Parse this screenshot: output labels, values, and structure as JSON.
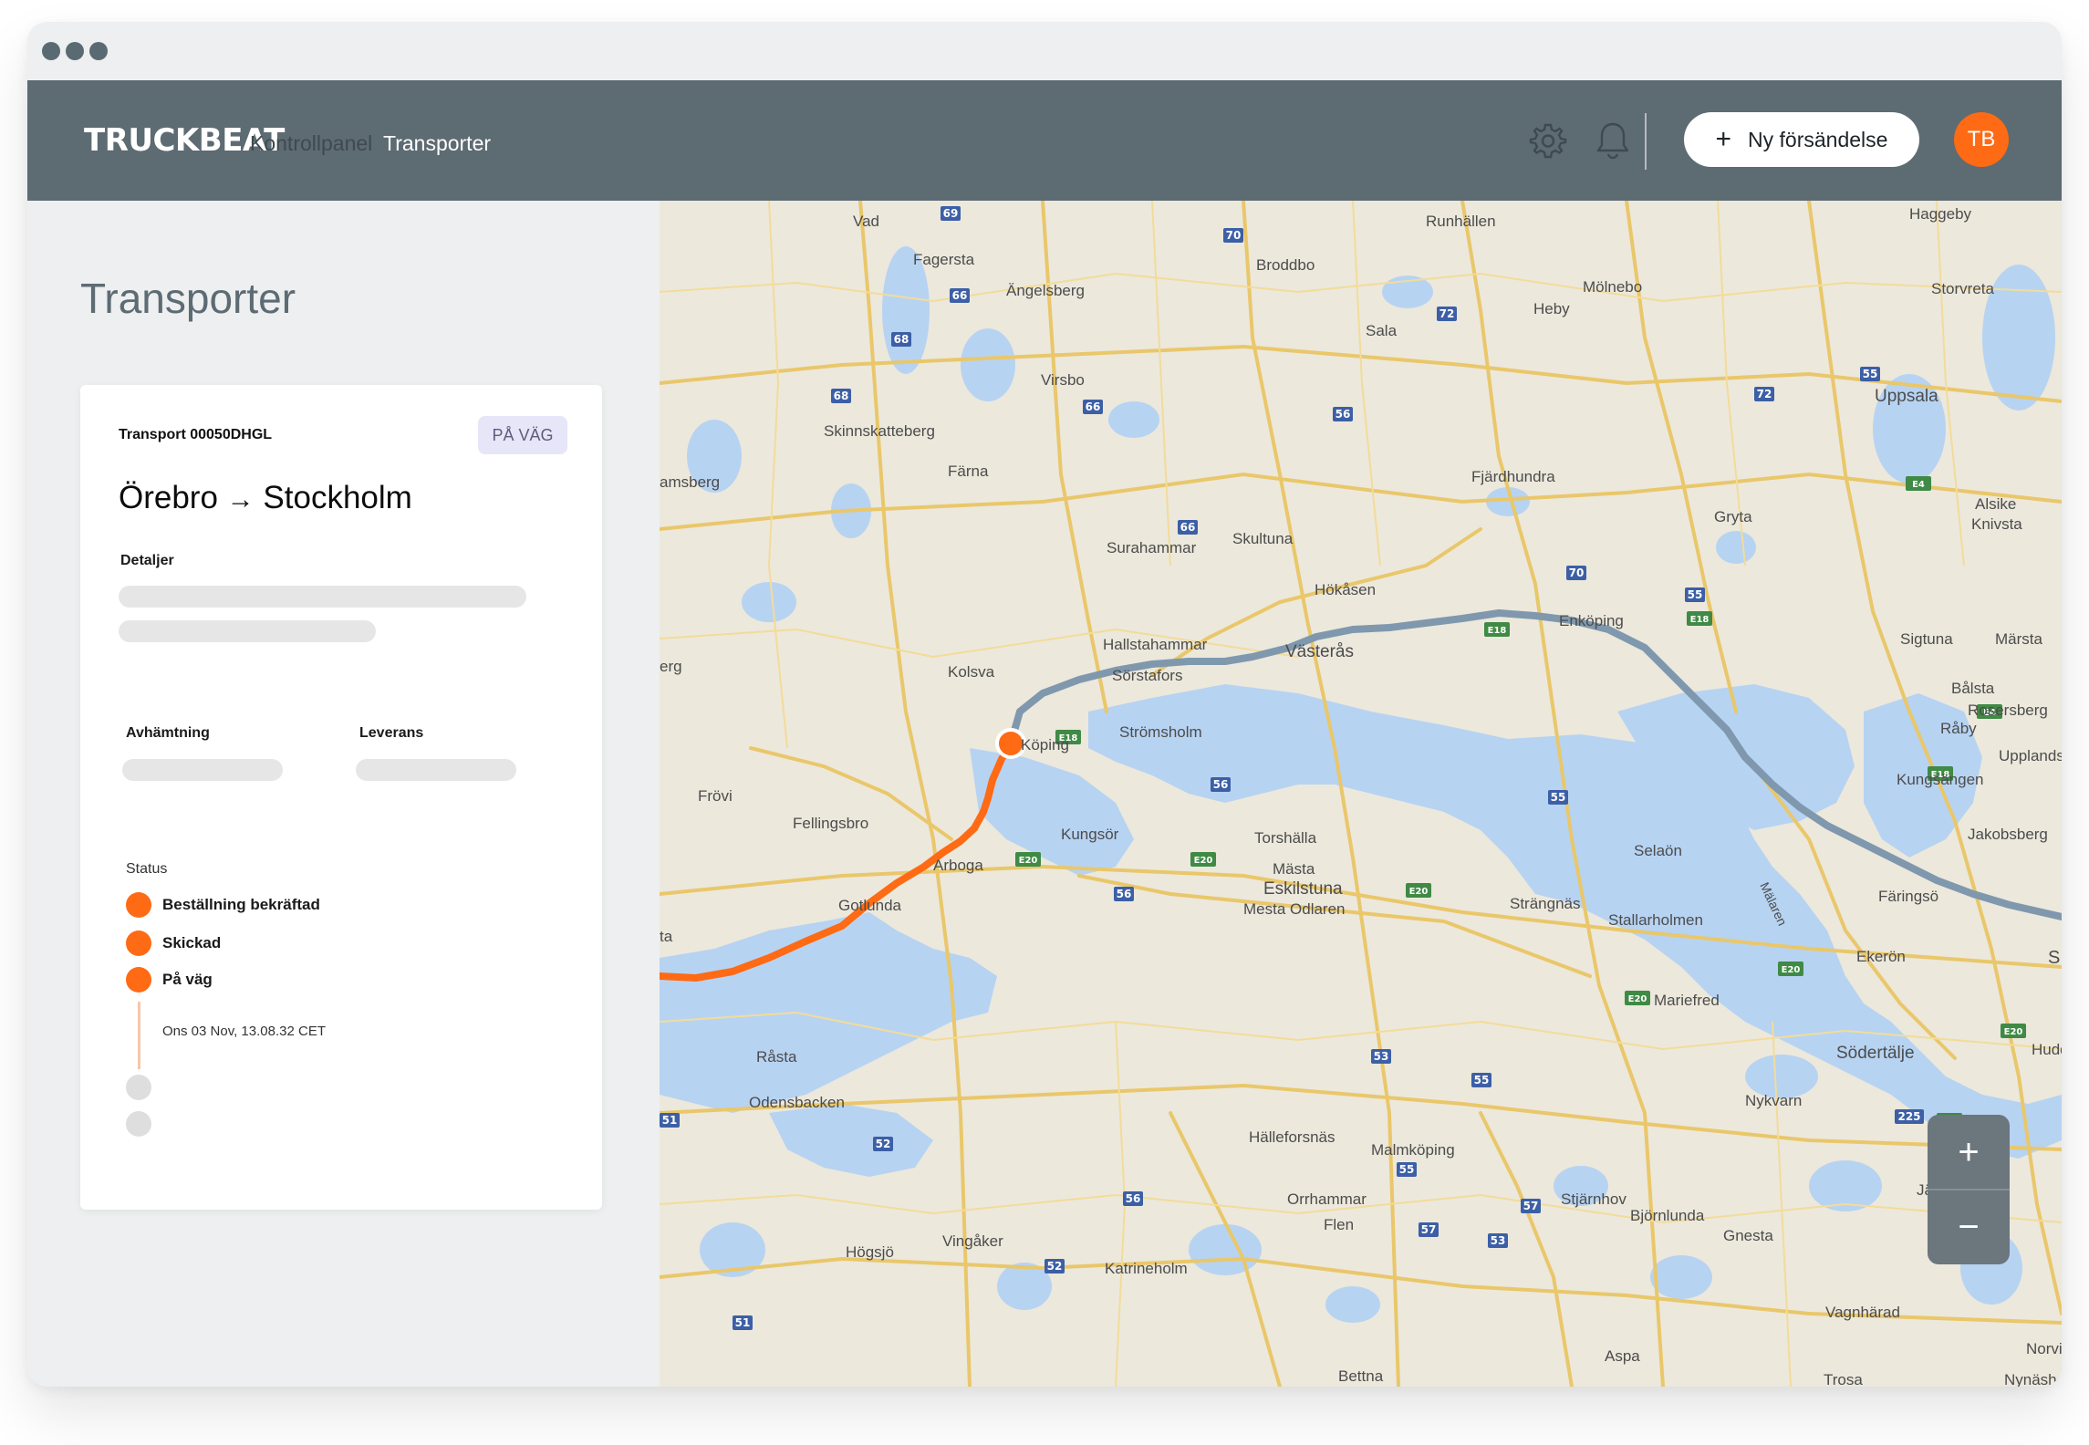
{
  "header": {
    "logo": "TRUCKBEAT",
    "nav": [
      {
        "label": "Kontrollpanel",
        "active": false
      },
      {
        "label": "Transporter",
        "active": true
      }
    ],
    "icons": [
      "gear-icon",
      "bell-icon"
    ],
    "new_shipment_label": "Ny försändelse",
    "avatar_initials": "TB"
  },
  "sidebar": {
    "title": "Transporter",
    "card": {
      "transport_id": "Transport 00050DHGL",
      "badge": "PÅ VÄG",
      "route_from": "Örebro",
      "route_to": "Stockholm",
      "details_label": "Detaljer",
      "pickup_label": "Avhämtning",
      "delivery_label": "Leverans",
      "status_label": "Status",
      "status_steps": [
        {
          "label": "Beställning bekräftad",
          "done": true
        },
        {
          "label": "Skickad",
          "done": true
        },
        {
          "label": "På väg",
          "done": true,
          "timestamp": "Ons 03 Nov, 13.08.32 CET"
        },
        {
          "label": "",
          "done": false
        },
        {
          "label": "",
          "done": false
        }
      ]
    }
  },
  "map": {
    "colors": {
      "traveled": "#ff6a14",
      "remaining": "#7f98ad",
      "water": "#b7d3f2",
      "land": "#ece8dc",
      "road": "#e9c76a",
      "road_shield": "#3c5fa6"
    },
    "places": [
      "Vad",
      "Fagersta",
      "Ängelsberg",
      "Runhällen",
      "Broddbo",
      "Haggeby",
      "Mölnebo",
      "Heby",
      "Sala",
      "Storvreta",
      "Uppsala",
      "Virsbo",
      "Skinnskatteberg",
      "Färna",
      "Fjärdhundra",
      "Gryta",
      "Alsike",
      "Knivsta",
      "Surahammar",
      "Skultuna",
      "Hökåsen",
      "Hallstahammar",
      "Västerås",
      "Enköping",
      "Sigtuna",
      "Märsta",
      "Sörstafors",
      "Kolsva",
      "Köping",
      "Strömsholm",
      "Bålsta",
      "Råby",
      "Rosersberg",
      "Upplands Väsby",
      "Frövi",
      "Fellingsbro",
      "Kungsör",
      "Torshälla",
      "Selaön",
      "Kungsängen",
      "Jakobsberg",
      "Arboga",
      "Mälaren",
      "Gotlunda",
      "Mästa",
      "Eskilstuna",
      "Strängnäs",
      "Färingsö",
      "Mesta Odlaren",
      "Stallarholmen",
      "Ekerön",
      "Mariefred",
      "Råsta",
      "Södertälje",
      "Odensbacken",
      "Nykvarn",
      "Hälleforsnäs",
      "Malmköping",
      "Hudd",
      "Orrhammar",
      "Stjärnhov",
      "Järna",
      "Flen",
      "Björnlunda",
      "Gnesta",
      "Högsjö",
      "Vingåker",
      "Katrineholm",
      "Vagnhärad",
      "Aspa",
      "Bettna",
      "Trosa",
      "Norvi",
      "Nynäsha",
      "amsberg",
      "erg",
      "ta",
      "S"
    ],
    "road_numbers": [
      "69",
      "70",
      "66",
      "72",
      "68",
      "66",
      "56",
      "55",
      "68",
      "72",
      "66",
      "70",
      "55",
      "E18",
      "E18",
      "E18",
      "E18",
      "56",
      "55",
      "E20",
      "E20",
      "56",
      "E20",
      "E4",
      "E20",
      "53",
      "55",
      "E20",
      "225",
      "52",
      "55",
      "56",
      "57",
      "53",
      "57",
      "52",
      "51",
      "51",
      "E4",
      "E20",
      "E4"
    ]
  },
  "zoom": {
    "in_label": "+",
    "out_label": "−"
  }
}
